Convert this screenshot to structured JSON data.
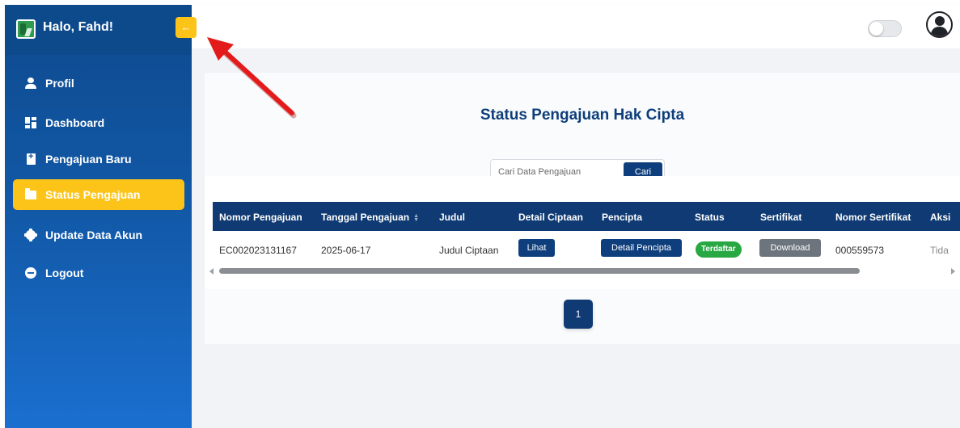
{
  "sidebar": {
    "greeting": "Halo, Fahd!",
    "collapse_icon": "←",
    "items": [
      {
        "label": "Profil",
        "icon": "user-icon"
      },
      {
        "label": "Dashboard",
        "icon": "dashboard-icon"
      },
      {
        "label": "Pengajuan Baru",
        "icon": "file-plus-icon"
      },
      {
        "label": "Status Pengajuan",
        "icon": "folder-icon",
        "active": true
      },
      {
        "label": "Update Data Akun",
        "icon": "gear-icon"
      },
      {
        "label": "Logout",
        "icon": "logout-icon"
      }
    ]
  },
  "topbar": {
    "theme_toggle": "off",
    "avatar_icon": "user-circle-icon"
  },
  "main": {
    "title": "Status Pengajuan Hak Cipta",
    "search": {
      "placeholder": "Cari Data Pengajuan",
      "button": "Cari"
    },
    "table": {
      "headers": [
        "Nomor Pengajuan",
        "Tanggal Pengajuan",
        "Judul",
        "Detail Ciptaan",
        "Pencipta",
        "Status",
        "Sertifikat",
        "Nomor Sertifikat",
        "Aksi"
      ],
      "rows": [
        {
          "nomor_pengajuan": "EC002023131167",
          "tanggal": "2025-06-17",
          "judul": "Judul Ciptaan",
          "detail_btn": "Lihat",
          "pencipta_btn": "Detail Pencipta",
          "status": "Terdaftar",
          "sertifikat_btn": "Download",
          "nomor_sertifikat": "000559573",
          "aksi": "Tida"
        }
      ]
    },
    "pagination": {
      "current": "1"
    }
  },
  "colors": {
    "sidebar": "#0e4a8e",
    "accent": "#fcc419",
    "primary": "#0f3a73",
    "success": "#27a843",
    "annotation_arrow": "#e31b1b"
  }
}
